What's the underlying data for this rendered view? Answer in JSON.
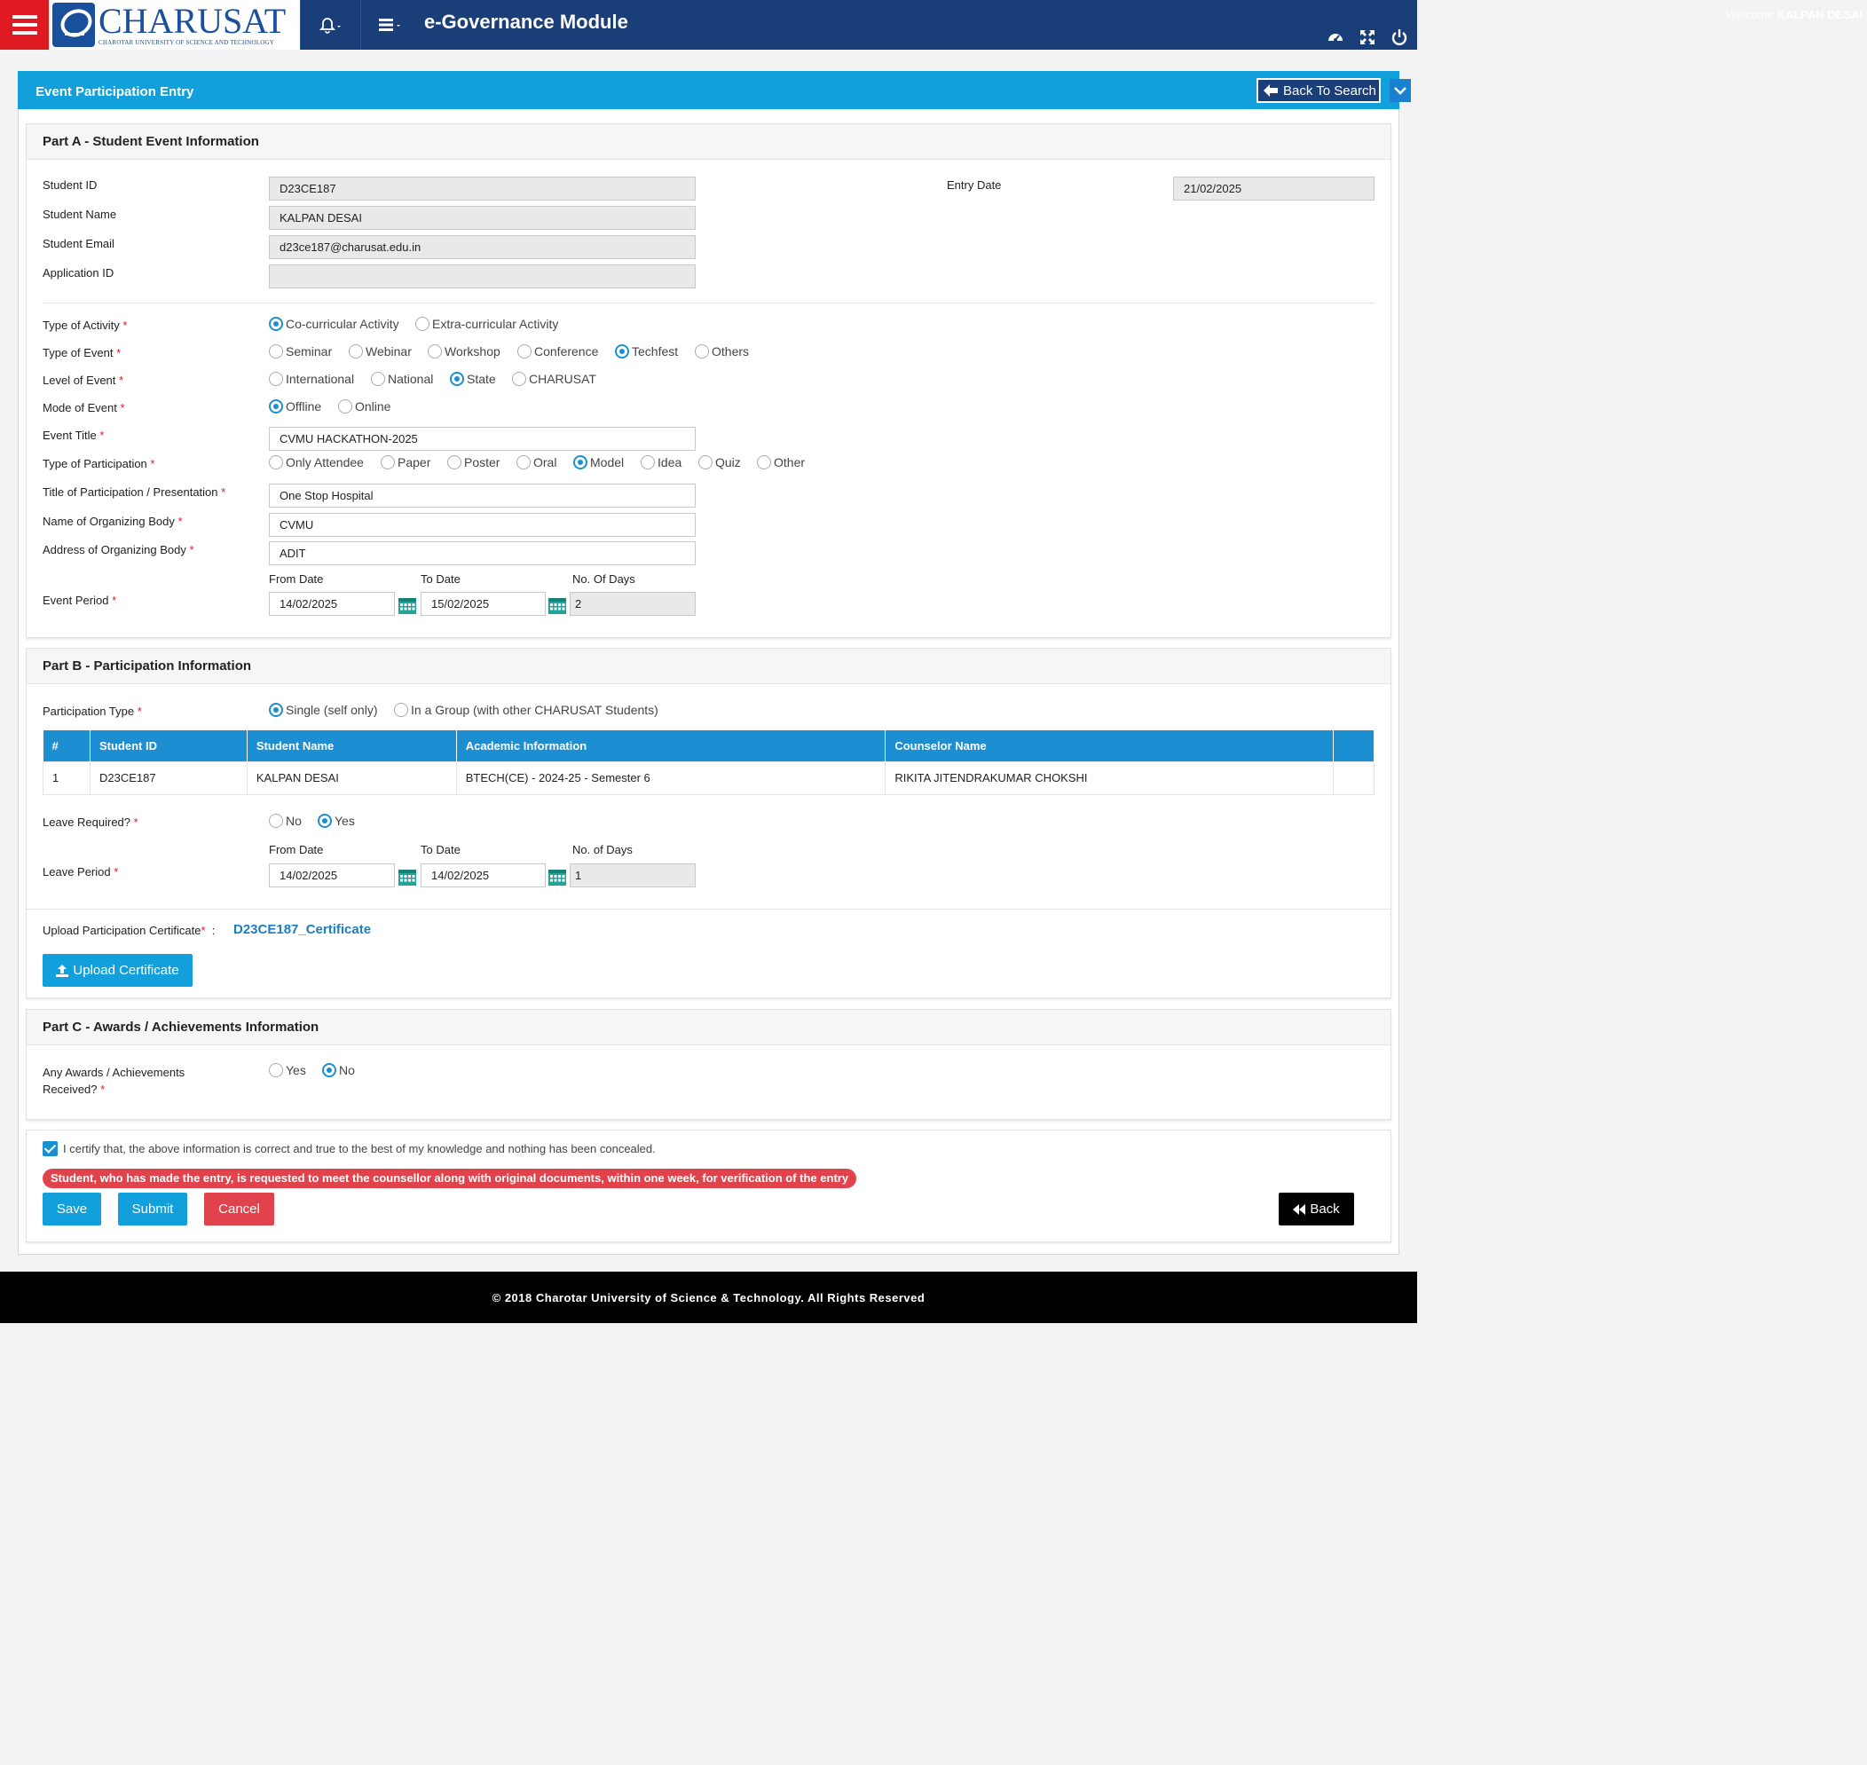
{
  "header": {
    "logo_name": "CHARUSAT",
    "logo_sub": "CHAROTAR UNIVERSITY OF SCIENCE AND TECHNOLOGY",
    "app_title": "e-Governance Module",
    "welcome_prefix": "Welcome",
    "user_name": "KALPAN DESAI",
    "icons": [
      "menu-icon",
      "bell-icon",
      "list-icon",
      "dashboard-icon",
      "fullscreen-icon",
      "power-icon"
    ]
  },
  "panel": {
    "title": "Event Participation Entry",
    "back_to_search": "Back To Search"
  },
  "part_a": {
    "heading": "Part A - Student Event Information",
    "student_id_label": "Student ID",
    "student_id": "D23CE187",
    "student_name_label": "Student Name",
    "student_name": "KALPAN DESAI",
    "student_email_label": "Student Email",
    "student_email": "d23ce187@charusat.edu.in",
    "application_id_label": "Application ID",
    "application_id": "",
    "entry_date_label": "Entry Date",
    "entry_date": "21/02/2025",
    "type_of_activity_label": "Type of Activity",
    "activity_options": [
      "Co-curricular Activity",
      "Extra-curricular Activity"
    ],
    "type_of_event_label": "Type of Event",
    "event_type_options": [
      "Seminar",
      "Webinar",
      "Workshop",
      "Conference",
      "Techfest",
      "Others"
    ],
    "level_of_event_label": "Level of Event",
    "level_options": [
      "International",
      "National",
      "State",
      "CHARUSAT"
    ],
    "mode_of_event_label": "Mode of Event",
    "mode_options": [
      "Offline",
      "Online"
    ],
    "event_title_label": "Event Title",
    "event_title": "CVMU HACKATHON-2025",
    "type_of_participation_label": "Type of Participation",
    "participation_options": [
      "Only Attendee",
      "Paper",
      "Poster",
      "Oral",
      "Model",
      "Idea",
      "Quiz",
      "Other"
    ],
    "title_of_participation_label": "Title of Participation / Presentation",
    "title_of_participation": "One Stop Hospital",
    "organizing_body_label": "Name of Organizing Body",
    "organizing_body": "CVMU",
    "organizing_address_label": "Address of Organizing Body",
    "organizing_address": "ADIT",
    "event_period_label": "Event Period",
    "from_date_label": "From Date",
    "to_date_label": "To Date",
    "no_of_days_label": "No. Of Days",
    "from_date": "14/02/2025",
    "to_date": "15/02/2025",
    "no_of_days": "2"
  },
  "part_b": {
    "heading": "Part B - Participation Information",
    "participation_type_label": "Participation Type",
    "participation_type_options": [
      "Single (self only)",
      "In a Group (with other CHARUSAT Students)"
    ],
    "table_headers": [
      "#",
      "Student ID",
      "Student Name",
      "Academic Information",
      "Counselor Name",
      ""
    ],
    "table_rows": [
      [
        "1",
        "D23CE187",
        "KALPAN DESAI",
        "BTECH(CE) - 2024-25 - Semester 6",
        "RIKITA JITENDRAKUMAR CHOKSHI",
        ""
      ]
    ],
    "leave_required_label": "Leave Required?",
    "leave_options": [
      "No",
      "Yes"
    ],
    "leave_period_label": "Leave Period",
    "from_date_label": "From Date",
    "to_date_label": "To Date",
    "no_of_days_label": "No. of Days",
    "leave_from": "14/02/2025",
    "leave_to": "14/02/2025",
    "leave_days": "1",
    "upload_label": "Upload Participation Certificate",
    "upload_colon": ":",
    "certificate_link": "D23CE187_Certificate",
    "upload_button": "Upload Certificate"
  },
  "part_c": {
    "heading": "Part C - Awards / Achievements Information",
    "awards_label_1": "Any Awards / Achievements",
    "awards_label_2": "Received?",
    "awards_options": [
      "Yes",
      "No"
    ]
  },
  "footer_actions": {
    "certify_text": "I certify that, the above information is correct and true to the best of my knowledge and nothing has been concealed.",
    "notice": "Student, who has made the entry, is requested to meet the counsellor along with original documents, within one week, for verification of the entry",
    "save": "Save",
    "submit": "Submit",
    "cancel": "Cancel",
    "back": "Back"
  },
  "footer": {
    "copyright": "© 2018 Charotar University of Science & Technology. All Rights Reserved"
  },
  "colors": {
    "header_bg": "#1a3e78",
    "menu_red": "#e01a22",
    "accent_blue": "#11a0dc",
    "table_head": "#1b8fd1",
    "danger": "#e0434b"
  }
}
